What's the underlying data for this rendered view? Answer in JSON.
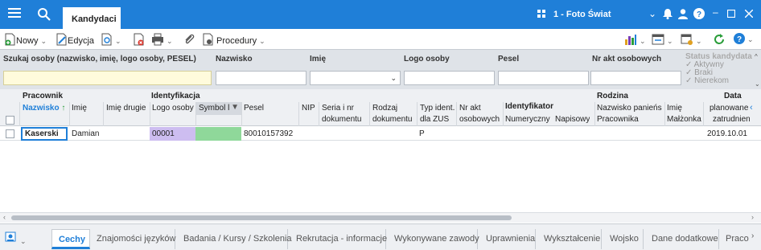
{
  "window": {
    "active_tab": "Kandydaci",
    "company": "1 - Foto Świat",
    "accent": "#1f7fd8"
  },
  "toolbar": {
    "new_label": "Nowy",
    "edit_label": "Edycja",
    "procedures_label": "Procedury"
  },
  "filters": {
    "search_label": "Szukaj osoby (nazwisko, imię, logo osoby, PESEL)",
    "nazwisko_label": "Nazwisko",
    "imie_label": "Imię",
    "logo_label": "Logo osoby",
    "pesel_label": "Pesel",
    "nr_akt_label": "Nr akt osobowych",
    "status_label": "Status kandydata",
    "status_options": [
      "Aktywny",
      "Braki",
      "Nierekom"
    ]
  },
  "grid": {
    "groups": {
      "pracownik": "Pracownik",
      "identyfikacja": "Identyfikacja",
      "rodzina": "Rodzina",
      "data": "Data",
      "identyfikator": "Identyfikator"
    },
    "columns": {
      "nazwisko": "Nazwisko",
      "imie": "Imię",
      "imie_drugie": "Imię drugie",
      "logo_osoby": "Logo osoby",
      "symbol": "Symbol l",
      "pesel": "Pesel",
      "nip": "NIP",
      "seria_1": "Seria i nr",
      "seria_2": "dokumentu",
      "rodzaj_1": "Rodzaj",
      "rodzaj_2": "dokumentu",
      "typ_1": "Typ ident.",
      "typ_2": "dla ZUS",
      "nr_akt_1": "Nr akt",
      "nr_akt_2": "osobowych",
      "numeryczny": "Numeryczny",
      "napisowy": "Napisowy",
      "nazwisko_pan": "Nazwisko panieńs",
      "pracownika": "Pracownika",
      "imie_malz": "Imię",
      "malzonka": "Małżonka",
      "planowane": "planowane",
      "zatrudnienia": "zatrudnien"
    },
    "rows": [
      {
        "nazwisko": "Kaserski",
        "imie": "Damian",
        "logo": "00001",
        "pesel": "80010157392",
        "typ": "P",
        "data": "2019.10.01"
      }
    ]
  },
  "bottom_tabs": [
    "Cechy",
    "Znajomości języków",
    "Badania / Kursy / Szkolenia",
    "Rekrutacja - informacje",
    "Wykonywane zawody",
    "Uprawnienia",
    "Wykształcenie",
    "Wojsko",
    "Dane dodatkowe",
    "Praco"
  ]
}
